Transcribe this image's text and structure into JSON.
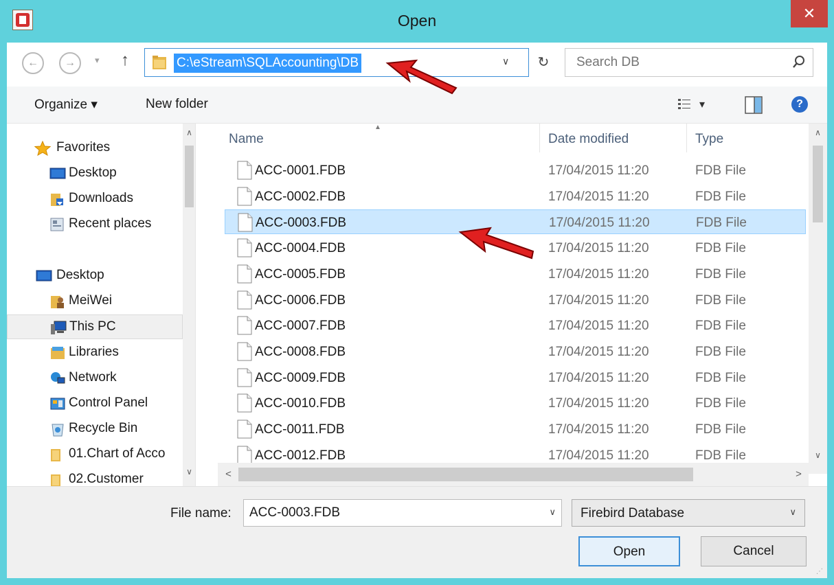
{
  "window": {
    "title": "Open",
    "close_glyph": "✕",
    "colors": {
      "frame": "#5fd1dc",
      "close": "#c7453f",
      "accent": "#3399ff",
      "selection": "#cce8ff"
    }
  },
  "nav": {
    "back_glyph": "←",
    "forward_glyph": "→",
    "history_glyph": "▾",
    "up_glyph": "↑",
    "address": "C:\\eStream\\SQLAccounting\\DB",
    "address_dropdown_glyph": "∨",
    "refresh_glyph": "↻",
    "search_placeholder": "Search DB"
  },
  "toolbar": {
    "organize_label": "Organize ▾",
    "new_folder_label": "New folder",
    "view_dropdown_glyph": "▾",
    "help_glyph": "?"
  },
  "sidebar": {
    "scroll_up_glyph": "∧",
    "scroll_down_glyph": "∨",
    "items": [
      {
        "label": "Favorites",
        "icon": "star-icon"
      },
      {
        "label": "Desktop",
        "icon": "desktop-icon"
      },
      {
        "label": "Downloads",
        "icon": "downloads-folder-icon"
      },
      {
        "label": "Recent places",
        "icon": "recent-places-icon"
      },
      {
        "label": "Desktop",
        "icon": "desktop-icon"
      },
      {
        "label": "MeiWei",
        "icon": "user-folder-icon"
      },
      {
        "label": "This PC",
        "icon": "computer-icon"
      },
      {
        "label": "Libraries",
        "icon": "libraries-icon"
      },
      {
        "label": "Network",
        "icon": "network-icon"
      },
      {
        "label": "Control Panel",
        "icon": "control-panel-icon"
      },
      {
        "label": "Recycle Bin",
        "icon": "recycle-bin-icon"
      },
      {
        "label": "01.Chart of Acco",
        "icon": "folder-icon"
      },
      {
        "label": "02.Customer",
        "icon": "folder-icon"
      }
    ]
  },
  "file_list": {
    "columns": {
      "name": "Name",
      "date": "Date modified",
      "type": "Type"
    },
    "sort_glyph": "▲",
    "scroll_up_glyph": "∧",
    "scroll_down_glyph": "∨",
    "scroll_left_glyph": "<",
    "scroll_right_glyph": ">",
    "rows": [
      {
        "name": "ACC-0001.FDB",
        "date": "17/04/2015 11:20",
        "type": "FDB File"
      },
      {
        "name": "ACC-0002.FDB",
        "date": "17/04/2015 11:20",
        "type": "FDB File"
      },
      {
        "name": "ACC-0003.FDB",
        "date": "17/04/2015 11:20",
        "type": "FDB File"
      },
      {
        "name": "ACC-0004.FDB",
        "date": "17/04/2015 11:20",
        "type": "FDB File"
      },
      {
        "name": "ACC-0005.FDB",
        "date": "17/04/2015 11:20",
        "type": "FDB File"
      },
      {
        "name": "ACC-0006.FDB",
        "date": "17/04/2015 11:20",
        "type": "FDB File"
      },
      {
        "name": "ACC-0007.FDB",
        "date": "17/04/2015 11:20",
        "type": "FDB File"
      },
      {
        "name": "ACC-0008.FDB",
        "date": "17/04/2015 11:20",
        "type": "FDB File"
      },
      {
        "name": "ACC-0009.FDB",
        "date": "17/04/2015 11:20",
        "type": "FDB File"
      },
      {
        "name": "ACC-0010.FDB",
        "date": "17/04/2015 11:20",
        "type": "FDB File"
      },
      {
        "name": "ACC-0011.FDB",
        "date": "17/04/2015 11:20",
        "type": "FDB File"
      },
      {
        "name": "ACC-0012.FDB",
        "date": "17/04/2015 11:20",
        "type": "FDB File"
      }
    ]
  },
  "bottom": {
    "filename_label": "File name:",
    "filename_value": "ACC-0003.FDB",
    "filename_dropdown_glyph": "∨",
    "filetype_label": "Firebird Database",
    "filetype_dropdown_glyph": "∨",
    "open_label": "Open",
    "cancel_label": "Cancel",
    "resize_glyph": "⋰"
  }
}
